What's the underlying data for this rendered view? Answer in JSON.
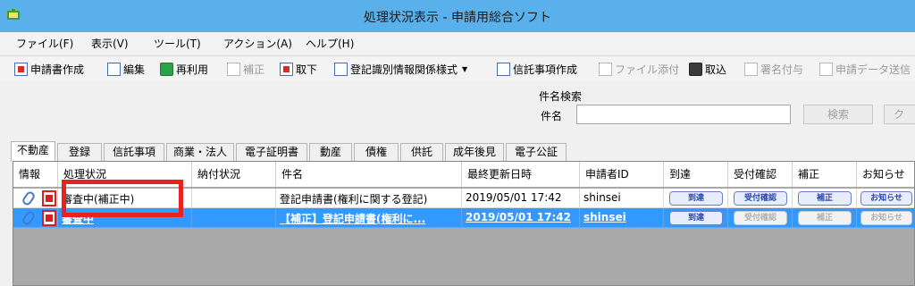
{
  "window": {
    "title": "処理状況表示 - 申請用総合ソフト",
    "app_icon": "app-icon"
  },
  "menu": [
    {
      "label": "ファイル(F)"
    },
    {
      "label": "表示(V)"
    },
    {
      "label": "ツール(T)"
    },
    {
      "label": "アクション(A)"
    },
    {
      "label": "ヘルプ(H)"
    }
  ],
  "toolbar": [
    {
      "label": "申請書作成",
      "icon": "document-new-icon",
      "enabled": true
    },
    {
      "label": "編集",
      "icon": "edit-icon",
      "enabled": true
    },
    {
      "label": "再利用",
      "icon": "reuse-icon",
      "enabled": true
    },
    {
      "label": "補正",
      "icon": "amend-icon",
      "enabled": false
    },
    {
      "label": "取下",
      "icon": "withdraw-icon",
      "enabled": true
    },
    {
      "label": "登記識別情報関係様式",
      "icon": "registry-form-icon",
      "enabled": true
    },
    {
      "label": "信託事項作成",
      "icon": "trust-icon",
      "enabled": true
    },
    {
      "label": "ファイル添付",
      "icon": "attach-file-icon",
      "enabled": false
    },
    {
      "label": "取込",
      "icon": "import-icon",
      "enabled": true
    },
    {
      "label": "署名付与",
      "icon": "sign-icon",
      "enabled": false
    },
    {
      "label": "申請データ送信",
      "icon": "send-data-icon",
      "enabled": false
    }
  ],
  "search": {
    "title": "件名検索",
    "label": "件名",
    "value": "",
    "search_button": "検索",
    "clear_button": "ク"
  },
  "tabs": [
    {
      "label": "不動産",
      "active": true
    },
    {
      "label": "登録"
    },
    {
      "label": "信託事項"
    },
    {
      "label": "商業・法人"
    },
    {
      "label": "電子証明書"
    },
    {
      "label": "動産"
    },
    {
      "label": "債権"
    },
    {
      "label": "供託"
    },
    {
      "label": "成年後見"
    },
    {
      "label": "電子公証"
    }
  ],
  "grid": {
    "columns": [
      "情報",
      "処理状況",
      "納付状況",
      "件名",
      "最終更新日時",
      "申請者ID",
      "到達",
      "受付確認",
      "補正",
      "お知らせ"
    ],
    "rows": [
      {
        "status": "審査中(補正中)",
        "payment": "",
        "subject": "登記申請書(権利に関する登記)",
        "updated": "2019/05/01 17:42",
        "applicant": "shinsei",
        "buttons": {
          "arrival": "到達",
          "receipt": "受付確認",
          "amend": "補正",
          "notice": "お知らせ"
        },
        "buttons_enabled": {
          "arrival": true,
          "receipt": true,
          "amend": true,
          "notice": true
        },
        "selected": false
      },
      {
        "status": "審査中",
        "payment": "",
        "subject": "【補正】登記申請書(権利に...",
        "updated": "2019/05/01 17:42",
        "applicant": "shinsei",
        "buttons": {
          "arrival": "到達",
          "receipt": "受付確認",
          "amend": "補正",
          "notice": "お知らせ"
        },
        "buttons_enabled": {
          "arrival": true,
          "receipt": false,
          "amend": false,
          "notice": false
        },
        "selected": true
      }
    ]
  },
  "colors": {
    "titlebar": "#5ab0ea",
    "selection": "#3399ff",
    "highlight": "#e8221e"
  }
}
